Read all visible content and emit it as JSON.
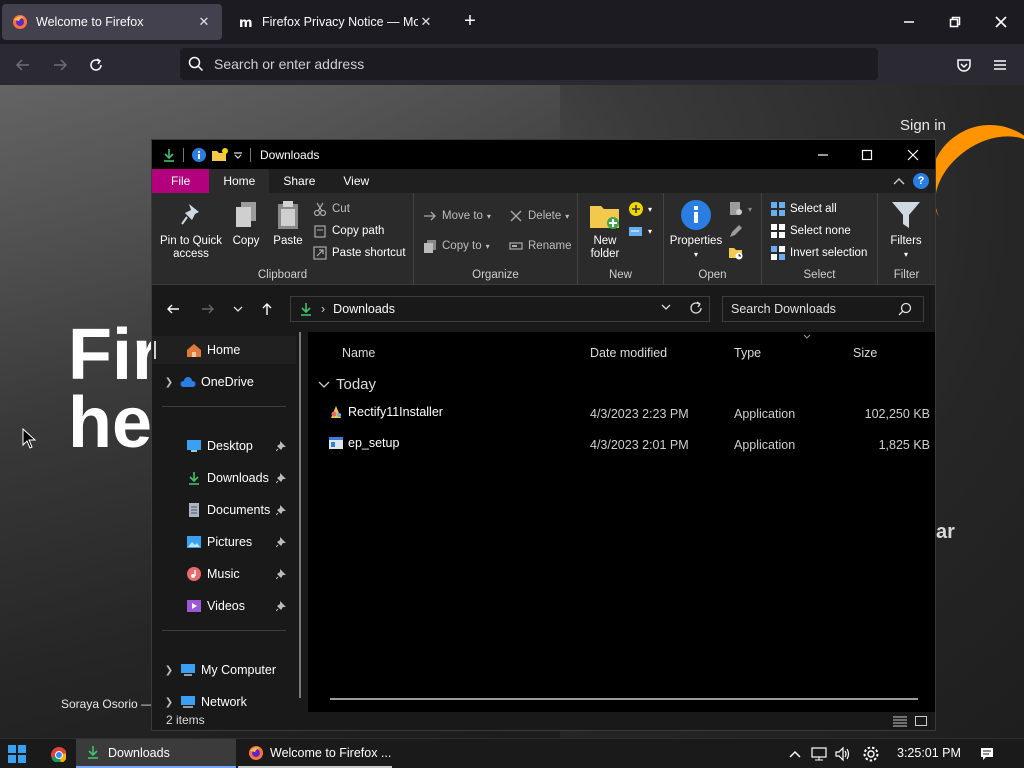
{
  "browser": {
    "tabs": [
      {
        "title": "Welcome to Firefox",
        "active": true
      },
      {
        "title": "Firefox Privacy Notice — Mozilla",
        "active": false
      }
    ],
    "urlbar_placeholder": "Search or enter address"
  },
  "webpage": {
    "sign_in": "Sign in",
    "hero_line1": "Fir",
    "hero_line2": "he",
    "photo_credit": "Soraya Osorio —",
    "side_fragment": "ar"
  },
  "explorer": {
    "window_title": "Downloads",
    "ribbon_tabs": [
      "File",
      "Home",
      "Share",
      "View"
    ],
    "ribbon": {
      "clipboard": {
        "label": "Clipboard",
        "pin": "Pin to Quick access",
        "copy": "Copy",
        "paste": "Paste",
        "cut": "Cut",
        "copy_path": "Copy path",
        "paste_shortcut": "Paste shortcut"
      },
      "organize": {
        "label": "Organize",
        "move_to": "Move to",
        "copy_to": "Copy to",
        "delete": "Delete",
        "rename": "Rename"
      },
      "new": {
        "label": "New",
        "new_folder_line1": "New",
        "new_folder_line2": "folder"
      },
      "open": {
        "label": "Open",
        "properties": "Properties"
      },
      "select": {
        "label": "Select",
        "select_all": "Select all",
        "select_none": "Select none",
        "invert": "Invert selection"
      },
      "filter": {
        "label": "Filter",
        "filters": "Filters"
      }
    },
    "address": {
      "location": "Downloads",
      "search_placeholder": "Search Downloads"
    },
    "nav": {
      "home": "Home",
      "onedrive": "OneDrive",
      "desktop": "Desktop",
      "downloads": "Downloads",
      "documents": "Documents",
      "pictures": "Pictures",
      "music": "Music",
      "videos": "Videos",
      "my_computer": "My Computer",
      "network": "Network"
    },
    "columns": {
      "name": "Name",
      "date": "Date modified",
      "type": "Type",
      "size": "Size"
    },
    "group": "Today",
    "files": [
      {
        "name": "Rectify11Installer",
        "date": "4/3/2023 2:23 PM",
        "type": "Application",
        "size": "102,250 KB"
      },
      {
        "name": "ep_setup",
        "date": "4/3/2023 2:01 PM",
        "type": "Application",
        "size": "1,825 KB"
      }
    ],
    "status": "2 items"
  },
  "taskbar": {
    "items": [
      {
        "label": "Downloads"
      },
      {
        "label": "Welcome to Firefox ..."
      }
    ],
    "clock": "3:25:01 PM"
  },
  "colors": {
    "file_tab": "#b3007c",
    "accent_blue": "#2a7de1",
    "firefox_orange": "#ff9400"
  }
}
